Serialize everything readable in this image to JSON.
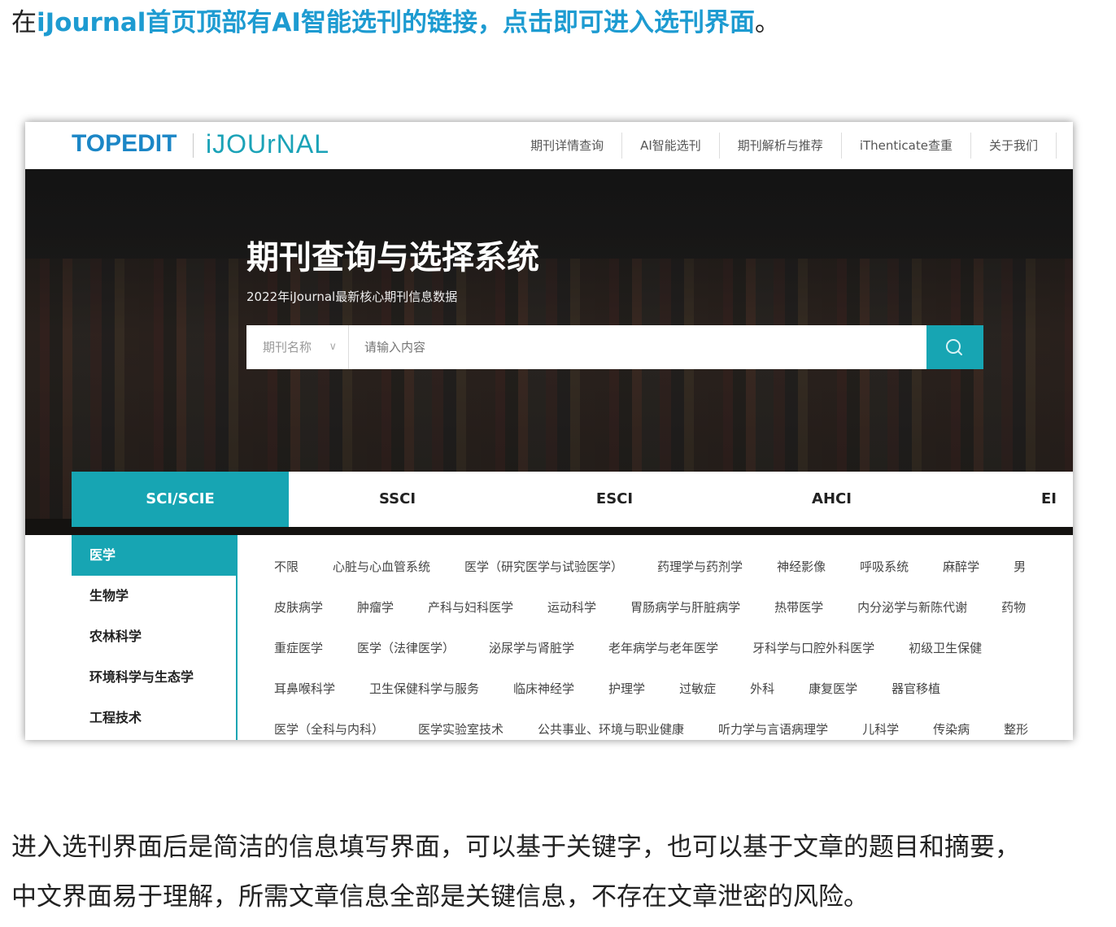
{
  "intro": {
    "prefix": "在",
    "highlight": "iJournal首页顶部有AI智能选刊的链接，点击即可进入选刊界面",
    "suffix": "。"
  },
  "screenshot": {
    "logo_topedit": "TOPEDIT",
    "logo_ijournal": "iJOUrNAL",
    "nav": [
      "期刊详情查询",
      "AI智能选刊",
      "期刊解析与推荐",
      "iThenticate查重",
      "关于我们"
    ],
    "hero_title": "期刊查询与选择系统",
    "hero_subtitle": "2022年iJournal最新核心期刊信息数据",
    "search": {
      "type_value": "期刊名称",
      "placeholder": "请输入内容"
    },
    "tabs": [
      "SCI/SCIE",
      "SSCI",
      "ESCI",
      "AHCI",
      "EI"
    ],
    "sidebar": [
      "医学",
      "生物学",
      "农林科学",
      "环境科学与生态学",
      "工程技术"
    ],
    "subjects": [
      [
        "不限",
        "心脏与心血管系统",
        "医学（研究医学与试验医学）",
        "药理学与药剂学",
        "神经影像",
        "呼吸系统",
        "麻醉学",
        "男"
      ],
      [
        "皮肤病学",
        "肿瘤学",
        "产科与妇科医学",
        "运动科学",
        "胃肠病学与肝脏病学",
        "热带医学",
        "内分泌学与新陈代谢",
        "药物"
      ],
      [
        "重症医学",
        "医学（法律医学）",
        "泌尿学与肾脏学",
        "老年病学与老年医学",
        "牙科学与口腔外科医学",
        "初级卫生保健"
      ],
      [
        "耳鼻喉科学",
        "卫生保健科学与服务",
        "临床神经学",
        "护理学",
        "过敏症",
        "外科",
        "康复医学",
        "器官移植"
      ],
      [
        "医学（全科与内科）",
        "医学实验室技术",
        "公共事业、环境与职业健康",
        "听力学与言语病理学",
        "儿科学",
        "传染病",
        "整形"
      ]
    ]
  },
  "outro": {
    "line1": "进入选刊界面后是简洁的信息填写界面，可以基于关键字，也可以基于文章的题目和摘要，",
    "line2": "中文界面易于理解，所需文章信息全部是关键信息，不存在文章泄密的风险。"
  }
}
